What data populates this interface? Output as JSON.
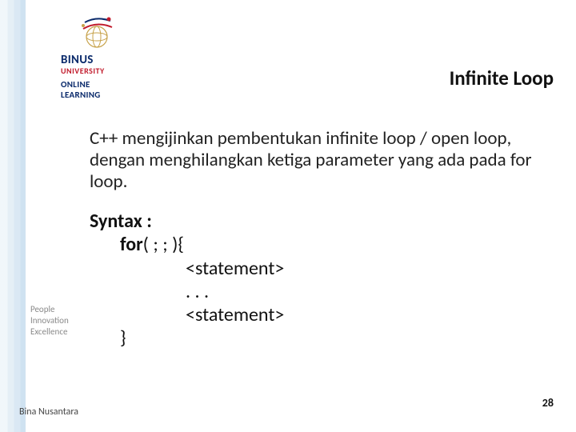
{
  "logo": {
    "binus": "BINUS",
    "university": "UNIVERSITY",
    "online": "ONLINE",
    "learning": "LEARNING"
  },
  "title": "Infinite Loop",
  "body": "C++ mengijinkan pembentukan infinite loop / open loop, dengan menghilangkan ketiga parameter yang ada pada for loop.",
  "syntax": {
    "label": "Syntax :",
    "for_kw": "for",
    "for_rest": "( ; ; ){",
    "stmt1": "<statement>",
    "dots": ". . .",
    "stmt2": "<statement>",
    "close": "}"
  },
  "tagline": {
    "l1": "People",
    "l2": "Innovation",
    "l3": "Excellence"
  },
  "footer": "Bina Nusantara",
  "page": "28"
}
